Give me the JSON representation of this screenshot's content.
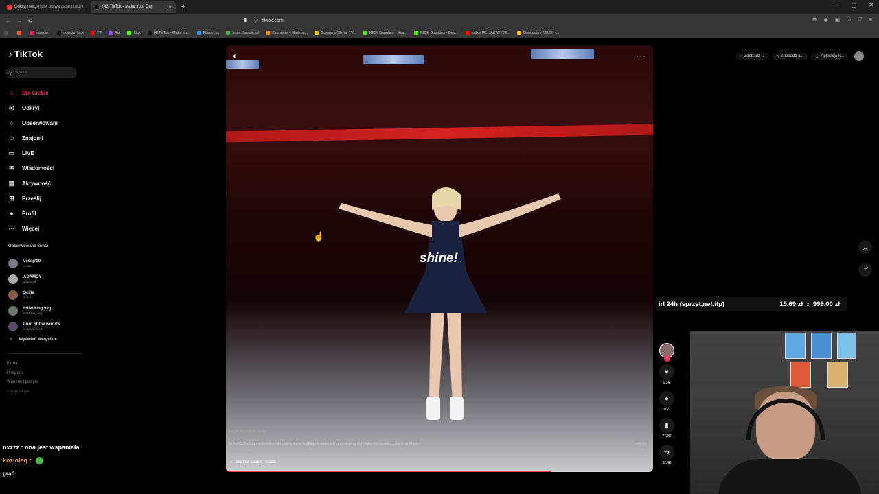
{
  "browser": {
    "tabs": [
      {
        "label": "Odkryj najczęściej odtwarzane utwory",
        "active": false,
        "color": "#e53935"
      },
      {
        "label": "(43)TikTok - Make Your Day",
        "active": true,
        "color": "#111111"
      }
    ],
    "new_tab": "+",
    "url": "tiktok.com",
    "bookmarks": [
      {
        "label": "",
        "color": "#555555"
      },
      {
        "label": "",
        "color": "#ff5722"
      },
      {
        "label": "nowciu_",
        "color": "#e91e63"
      },
      {
        "label": "nowciu_kick",
        "color": "#111111"
      },
      {
        "label": "YT",
        "color": "#ff0000"
      },
      {
        "label": "Rat",
        "color": "#9147ff"
      },
      {
        "label": "Kick",
        "color": "#53fc18"
      },
      {
        "label": "(4)TikTok - Make Yo...",
        "color": "#111111"
      },
      {
        "label": "Filman.cc",
        "color": "#2196f3"
      },
      {
        "label": "https://tangle.io/",
        "color": "#4caf50"
      },
      {
        "label": "Zagrajmy – Najleps...",
        "color": "#ff9800"
      },
      {
        "label": "Gomorra (Serial TV...",
        "color": "#ffc107"
      },
      {
        "label": "KICK Bounties - Hea...",
        "color": "#53fc18"
      },
      {
        "label": "KICK Bounties - Dea...",
        "color": "#53fc18"
      },
      {
        "label": "nutka IRL JAK WYJE...",
        "color": "#ff0000"
      },
      {
        "label": "Dom dobry (2025) -...",
        "color": "#ffc107"
      }
    ]
  },
  "tiktok": {
    "logo": "TikTok",
    "search_placeholder": "Szukaj",
    "menu": [
      {
        "label": "Dla Ciebie",
        "icon": "home-icon",
        "glyph": "⌂",
        "active": true
      },
      {
        "label": "Odkryj",
        "icon": "compass-icon",
        "glyph": "◎",
        "active": false
      },
      {
        "label": "Obserwowani",
        "icon": "following-icon",
        "glyph": "○",
        "active": false
      },
      {
        "label": "Znajomi",
        "icon": "friends-icon",
        "glyph": "☺",
        "active": false
      },
      {
        "label": "LIVE",
        "icon": "live-icon",
        "glyph": "▭",
        "active": false
      },
      {
        "label": "Wiadomości",
        "icon": "messages-icon",
        "glyph": "✉",
        "active": false
      },
      {
        "label": "Aktywność",
        "icon": "activity-icon",
        "glyph": "▤",
        "active": false
      },
      {
        "label": "Prześlij",
        "icon": "upload-icon",
        "glyph": "⊞",
        "active": false
      },
      {
        "label": "Profil",
        "icon": "profile-icon",
        "glyph": "●",
        "active": false
      },
      {
        "label": "Więcej",
        "icon": "more-icon",
        "glyph": "⋯",
        "active": false
      }
    ],
    "following_title": "Obserwowane konta",
    "following": [
      {
        "name": "vesaj700",
        "handle": "vesaj"
      },
      {
        "name": "ADAMCY",
        "handle": "adamcyd"
      },
      {
        "name": "Scilla",
        "handle": "scill.a"
      },
      {
        "name": "toilet.king.yeg",
        "handle": "toilet.king.yeg"
      },
      {
        "name": "Lord of the world's",
        "handle": "chujuwie.kto2"
      }
    ],
    "see_all": "Wyświetl wszystkie",
    "footer": [
      "Firma",
      "Program",
      "Warunki i polityki"
    ],
    "copyright": "© 2026 TikTok",
    "header_pills": [
      {
        "label": "Zdobądź ...",
        "icon": "coin-icon",
        "glyph": "◌"
      },
      {
        "label": "Zdobądź a...",
        "icon": "device-icon",
        "glyph": "▯"
      },
      {
        "label": "Aplikacja k...",
        "icon": "download-icon",
        "glyph": "⇣"
      }
    ]
  },
  "video": {
    "overlay_caption": "shine!",
    "author": "nicolelikemeskating",
    "description": "to NASZA złota medalistka olimpijska słysa liu@figureskating #figureskating #alysaliu #winterolympics #fyp #fanedit",
    "more_label": "więcej",
    "see_original": "Zobacz oryginał",
    "sound": "original sound - nicole",
    "progress": 0.76,
    "accent": "#fe2c55"
  },
  "actions": [
    {
      "name": "like",
      "glyph": "♥",
      "count": "1,3M"
    },
    {
      "name": "comment",
      "glyph": "●",
      "count": "3127"
    },
    {
      "name": "bookmark",
      "glyph": "▮",
      "count": "77,9K"
    },
    {
      "name": "share",
      "glyph": "↪",
      "count": "32,4K"
    }
  ],
  "stream": {
    "goal_label": "irl 24h (sprzet,net,itp)",
    "goal_current": "15,69 zł",
    "goal_sep": "z",
    "goal_target": "999,00 zł",
    "chat": [
      {
        "user": "nxzzz",
        "message": ": ona jest wspaniała"
      },
      {
        "user": "kozioleq",
        "message": ":"
      },
      {
        "user": "",
        "message": "grać"
      }
    ]
  }
}
